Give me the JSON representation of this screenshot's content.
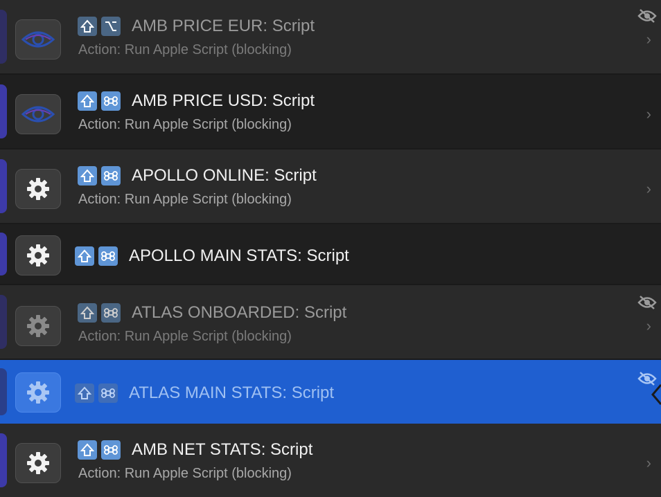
{
  "rows": [
    {
      "title": "AMB PRICE EUR: Script",
      "subtitle": "Action: Run Apple Script (blocking)",
      "icon": "eye-icon",
      "keys": [
        "shift-key-icon",
        "option-key-icon"
      ],
      "disabled": true
    },
    {
      "title": "AMB PRICE USD: Script",
      "subtitle": "Action: Run Apple Script (blocking)",
      "icon": "eye-icon",
      "keys": [
        "shift-key-icon",
        "command-key-icon"
      ],
      "disabled": false
    },
    {
      "title": "APOLLO ONLINE: Script",
      "subtitle": "Action: Run Apple Script (blocking)",
      "icon": "gear-icon",
      "keys": [
        "shift-key-icon",
        "command-key-icon"
      ],
      "disabled": false
    },
    {
      "title": "APOLLO MAIN STATS: Script",
      "subtitle": "",
      "icon": "gear-icon",
      "keys": [
        "shift-key-icon",
        "command-key-icon"
      ],
      "disabled": false
    },
    {
      "title": "ATLAS ONBOARDED: Script",
      "subtitle": "Action: Run Apple Script (blocking)",
      "icon": "gear-icon",
      "keys": [
        "shift-key-icon",
        "command-key-icon"
      ],
      "disabled": true
    },
    {
      "title": "ATLAS MAIN STATS: Script",
      "subtitle": "",
      "icon": "gear-icon",
      "keys": [
        "shift-key-icon",
        "command-key-icon"
      ],
      "disabled": true,
      "selected": true
    },
    {
      "title": "AMB NET STATS: Script",
      "subtitle": "Action: Run Apple Script (blocking)",
      "icon": "gear-icon",
      "keys": [
        "shift-key-icon",
        "command-key-icon"
      ],
      "disabled": false
    }
  ],
  "colors": {
    "selection": "#1f5fd0",
    "key_cap": "#5f95d6",
    "accent": "#3d3aa8"
  }
}
